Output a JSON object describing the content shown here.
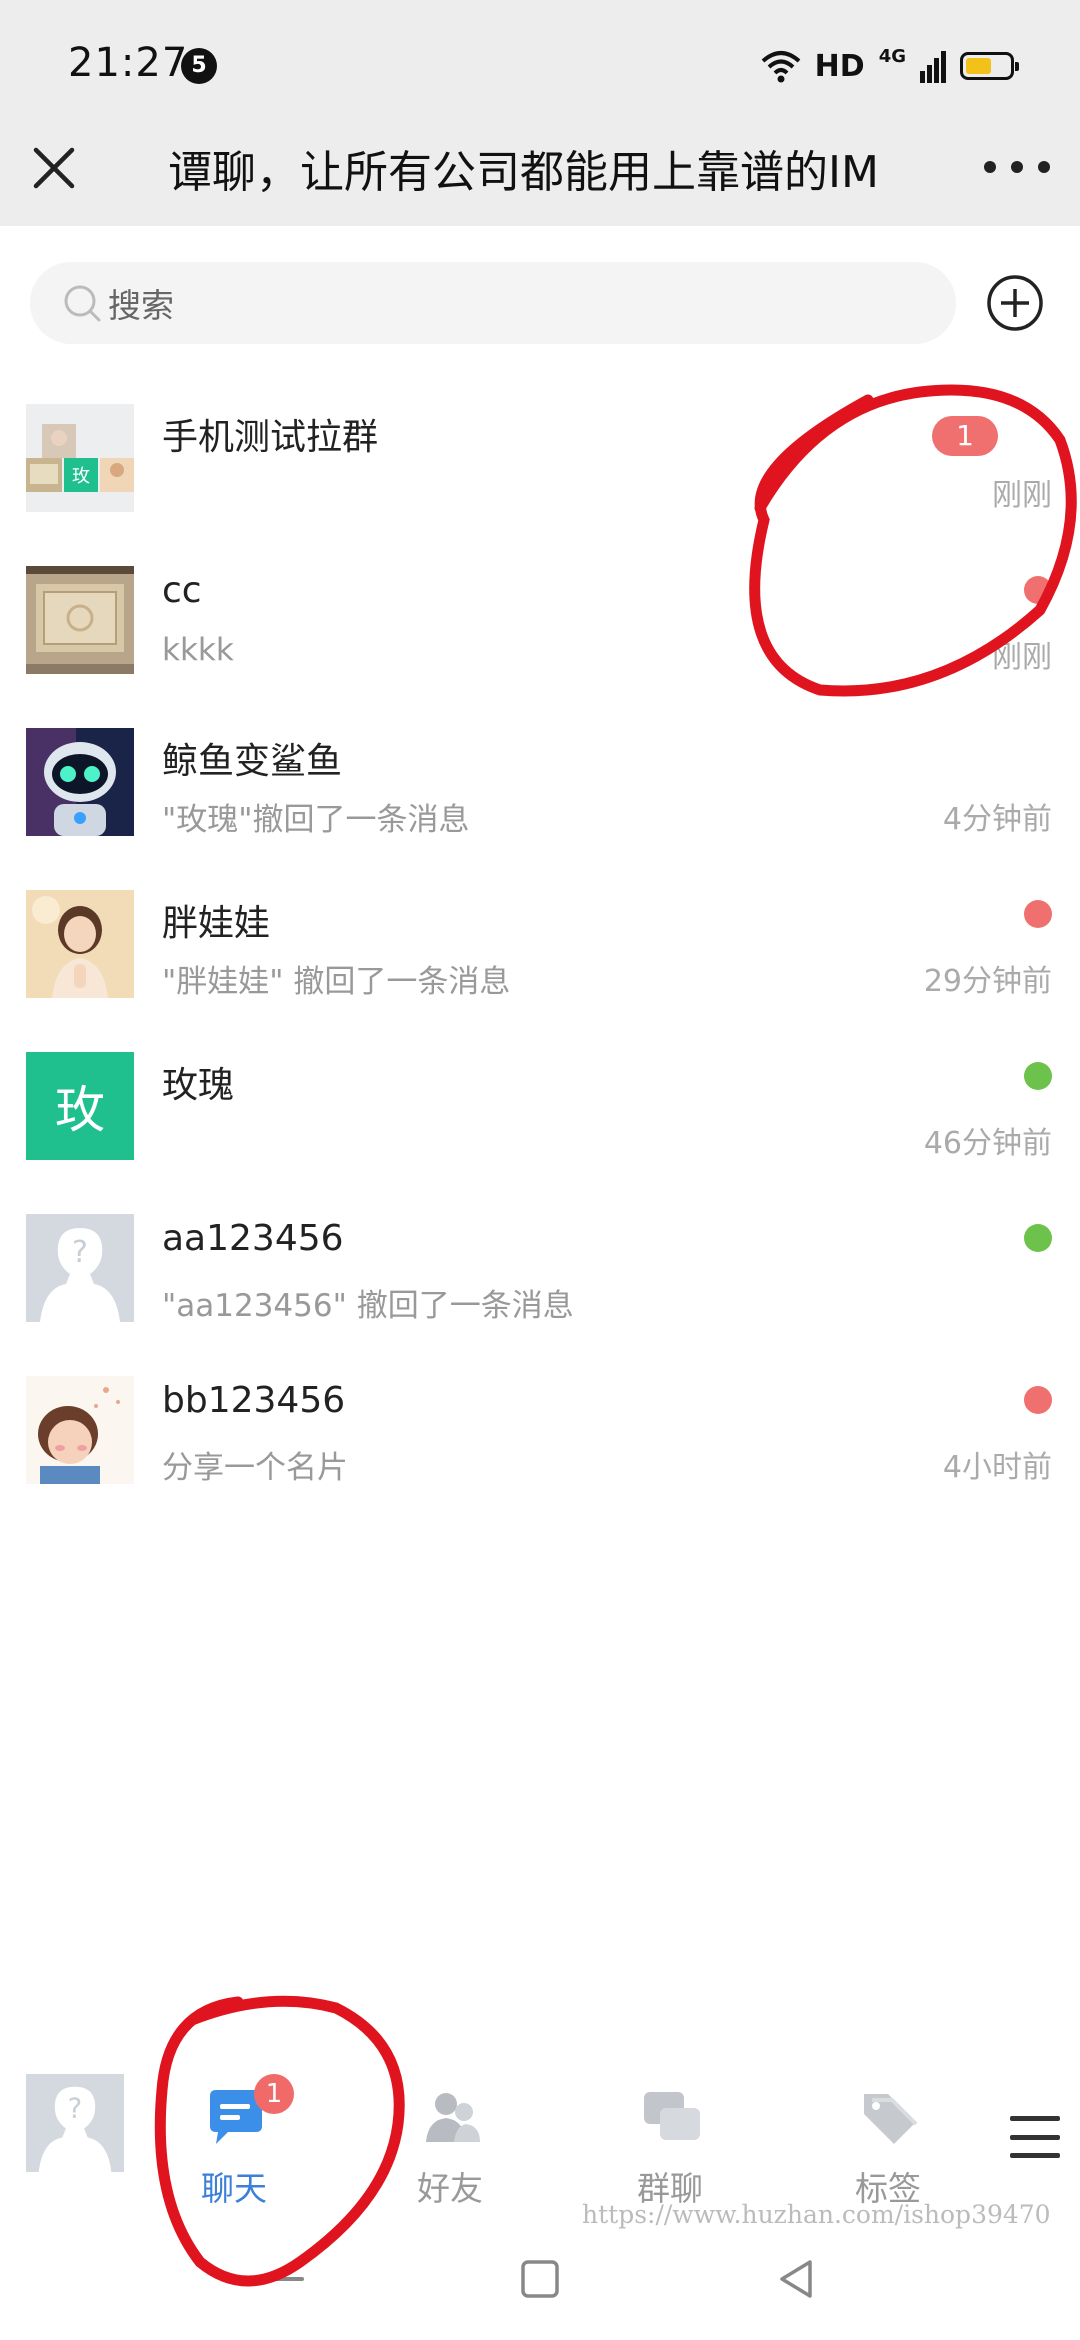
{
  "status_bar": {
    "time": "21:27",
    "notification_count": "5",
    "network_label": "HD",
    "cell_label": "4G"
  },
  "title_bar": {
    "title": "谭聊，让所有公司都能用上靠谱的IM",
    "close_icon": "close-icon",
    "more_icon": "more-dots-icon"
  },
  "search": {
    "placeholder": "搜索",
    "add_icon": "plus-circle-icon"
  },
  "chats": [
    {
      "name": "手机测试拉群",
      "preview": "",
      "time": "刚刚",
      "unread": "1",
      "dot": "",
      "avatar": "group-collage"
    },
    {
      "name": "cc",
      "preview": "kkkk",
      "time": "刚刚",
      "unread": "",
      "dot": "#f07070",
      "avatar": "building-photo"
    },
    {
      "name": "鲸鱼变鲨鱼",
      "preview": "\"玫瑰\"撤回了一条消息",
      "time": "4分钟前",
      "unread": "",
      "dot": "",
      "avatar": "robot-photo"
    },
    {
      "name": "胖娃娃",
      "preview": "\"胖娃娃\" 撤回了一条消息",
      "time": "29分钟前",
      "unread": "",
      "dot": "#f07070",
      "avatar": "girl-photo"
    },
    {
      "name": "玫瑰",
      "preview": "",
      "time": "46分钟前",
      "unread": "",
      "dot": "#6cc24a",
      "avatar": "letter",
      "avatar_letter": "玫"
    },
    {
      "name": "aa123456",
      "preview": "\"aa123456\" 撤回了一条消息",
      "time": "",
      "unread": "",
      "dot": "#6cc24a",
      "avatar": "default-user"
    },
    {
      "name": "bb123456",
      "preview": "分享一个名片",
      "time": "4小时前",
      "unread": "",
      "dot": "#f07070",
      "avatar": "child-photo"
    }
  ],
  "bottom_nav": {
    "tabs": [
      {
        "label": "聊天",
        "icon": "chat-bubble-icon",
        "active": true,
        "badge": "1"
      },
      {
        "label": "好友",
        "icon": "friends-icon",
        "active": false,
        "badge": ""
      },
      {
        "label": "群聊",
        "icon": "group-chat-icon",
        "active": false,
        "badge": ""
      },
      {
        "label": "标签",
        "icon": "tag-icon",
        "active": false,
        "badge": ""
      }
    ],
    "menu_icon": "hamburger-menu-icon",
    "watermark": "https://www.huzhan.com/ishop39470"
  },
  "colors": {
    "accent": "#3b7fd8",
    "unread_red": "#f07070",
    "online_green": "#6cc24a",
    "annotation_red": "#e0141e",
    "letter_avatar": "#1fc08e"
  }
}
